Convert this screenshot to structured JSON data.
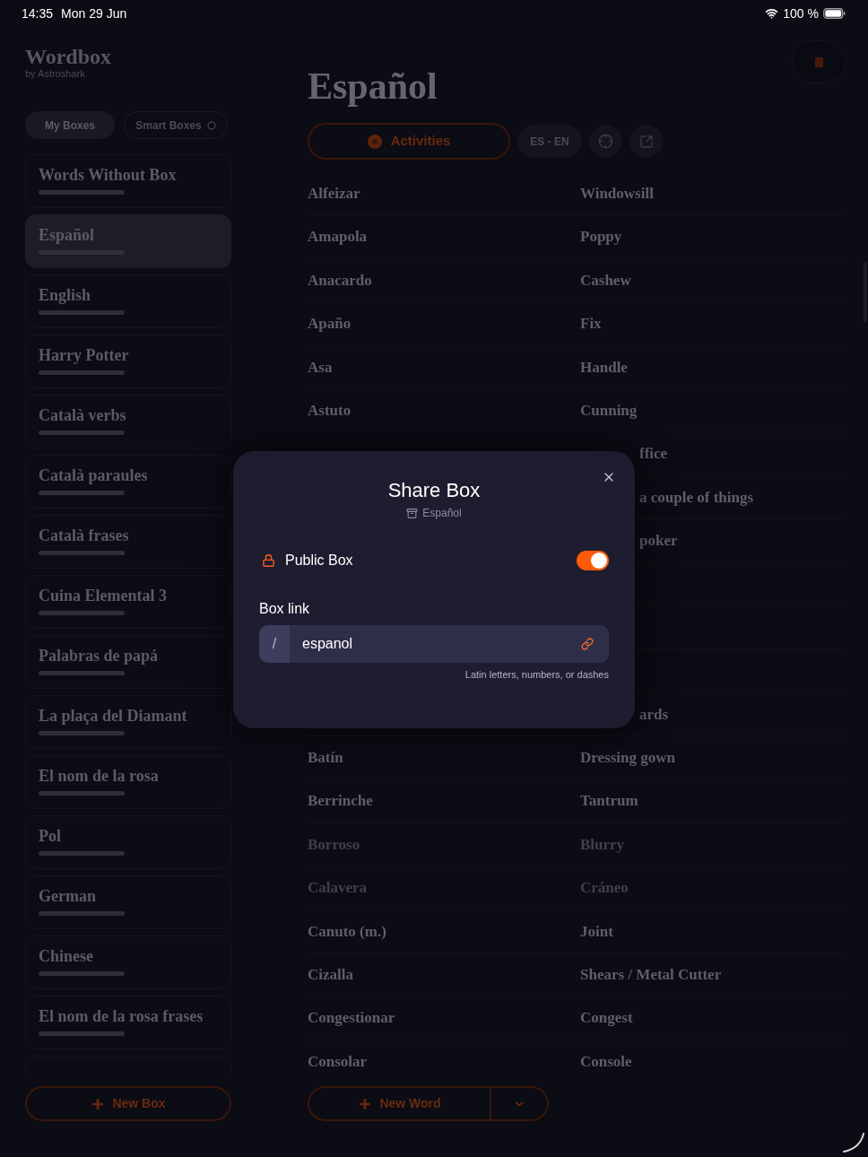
{
  "status_bar": {
    "time": "14:35",
    "date": "Mon 29 Jun",
    "battery": "100 %"
  },
  "sidebar": {
    "app_title": "Wordbox",
    "app_subtitle": "by Astroshark",
    "tabs": [
      {
        "label": "My Boxes",
        "selected": true
      },
      {
        "label": "Smart Boxes",
        "selected": false
      }
    ],
    "boxes": [
      {
        "name": "Words Without Box",
        "selected": false
      },
      {
        "name": "Español",
        "selected": true
      },
      {
        "name": "English",
        "selected": false
      },
      {
        "name": "Harry Potter",
        "selected": false
      },
      {
        "name": "Català verbs",
        "selected": false
      },
      {
        "name": "Català paraules",
        "selected": false
      },
      {
        "name": "Català frases",
        "selected": false
      },
      {
        "name": "Cuina Elemental 3",
        "selected": false
      },
      {
        "name": "Palabras de papá",
        "selected": false
      },
      {
        "name": "La plaça del Diamant",
        "selected": false
      },
      {
        "name": "El nom de la rosa",
        "selected": false
      },
      {
        "name": "Pol",
        "selected": false
      },
      {
        "name": "German",
        "selected": false
      },
      {
        "name": "Chinese",
        "selected": false
      },
      {
        "name": "El nom de la rosa frases",
        "selected": false
      },
      {
        "selected": false
      }
    ],
    "new_box_button": "New Box"
  },
  "main": {
    "title": "Español",
    "toolbar": {
      "activities_button": "Activities",
      "language_pair": "ES - EN"
    },
    "words": [
      {
        "kind": "word",
        "term": "Alfeizar",
        "translation": "Windowsill",
        "dimmed": false
      },
      {
        "kind": "word",
        "term": "Amapola",
        "translation": "Poppy",
        "dimmed": false
      },
      {
        "kind": "word",
        "term": "Anacardo",
        "translation": "Cashew",
        "dimmed": false
      },
      {
        "kind": "word",
        "term": "Apaño",
        "translation": "Fix",
        "dimmed": false
      },
      {
        "kind": "word",
        "term": "Asa",
        "translation": "Handle",
        "dimmed": false
      },
      {
        "kind": "word",
        "term": "Astuto",
        "translation": "Cunning",
        "dimmed": false
      },
      {
        "kind": "covered",
        "translation": "ffice"
      },
      {
        "kind": "covered",
        "translation": "a couple of things"
      },
      {
        "kind": "covered",
        "translation": "poker"
      },
      {
        "kind": "covered"
      },
      {
        "kind": "covered"
      },
      {
        "kind": "covered"
      },
      {
        "kind": "covered",
        "translation": "ards"
      },
      {
        "kind": "word",
        "term": "Batín",
        "translation": "Dressing gown",
        "dimmed": false
      },
      {
        "kind": "word",
        "term": "Berrinche",
        "translation": "Tantrum",
        "dimmed": false
      },
      {
        "kind": "word",
        "term": "Borroso",
        "translation": "Blurry",
        "dimmed": true
      },
      {
        "kind": "word",
        "term": "Calavera",
        "translation": "Cráneo",
        "dimmed": true
      },
      {
        "kind": "word",
        "term": "Canuto (m.)",
        "translation": "Joint",
        "dimmed": false
      },
      {
        "kind": "word",
        "term": "Cizalla",
        "translation": "Shears / Metal Cutter",
        "dimmed": false
      },
      {
        "kind": "word",
        "term": "Congestionar",
        "translation": "Congest",
        "dimmed": false
      },
      {
        "kind": "word",
        "term": "Consolar",
        "translation": "Console",
        "dimmed": false
      }
    ],
    "new_word_button": "New Word"
  },
  "dialog": {
    "title": "Share Box",
    "box_name": "Español",
    "public_box": {
      "label": "Public Box",
      "on": true
    },
    "link_field": {
      "label": "Box link",
      "prefix": "/",
      "value": "espanol",
      "hint": "Latin letters, numbers, or dashes"
    }
  }
}
